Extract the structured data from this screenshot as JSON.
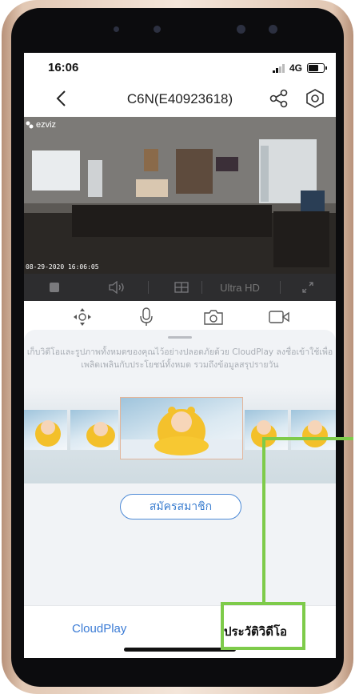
{
  "status_bar": {
    "time": "16:06",
    "network": "4G"
  },
  "nav": {
    "title": "C6N(E40923618)"
  },
  "video": {
    "brand": "ezviz",
    "timestamp": "08-29-2020 16:06:05"
  },
  "video_toolbar": {
    "quality_label": "Ultra HD"
  },
  "promo": {
    "text": "เก็บวิดีโอและรูปภาพทั้งหมดของคุณไว้อย่างปลอดภัยด้วย CloudPlay ลงชื่อเข้าใช้เพื่อเพลิดเพลินกับประโยชน์ทั้งหมด รวมถึงข้อมูลสรุปรายวัน",
    "subscribe_label": "สมัครสมาชิก"
  },
  "tabs": {
    "cloud_label": "CloudPlay",
    "history_label": "ประวัติวิดีโอ"
  },
  "colors": {
    "accent": "#3b7ed0",
    "annotation": "#7ecb4a"
  }
}
